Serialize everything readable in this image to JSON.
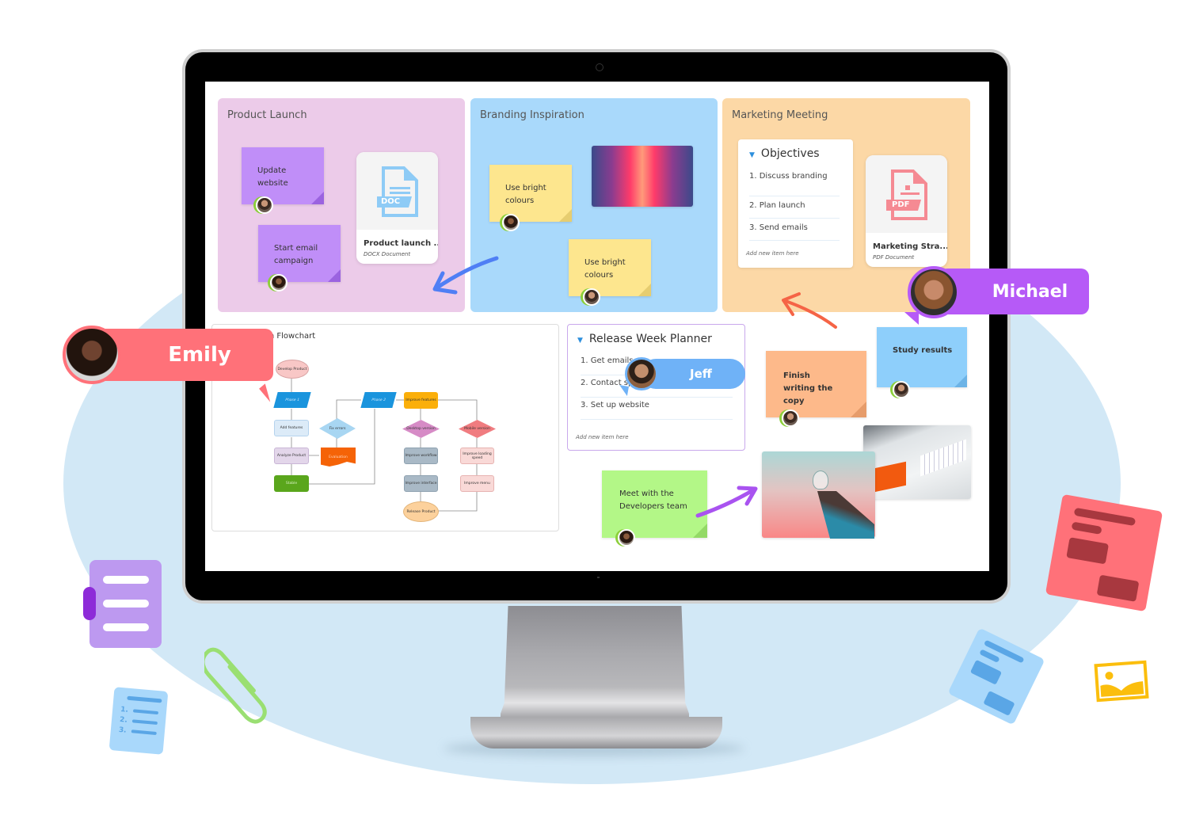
{
  "board": {
    "panels": [
      {
        "title": "Product Launch",
        "color": "#eccbe9"
      },
      {
        "title": "Branding Inspiration",
        "color": "#a9d9fb"
      },
      {
        "title": "Marketing Meeting",
        "color": "#fcd8a6"
      }
    ],
    "product_launch": {
      "stickies": [
        "Update website",
        "Start email campaign"
      ],
      "document": {
        "name": "Product launch ...",
        "type": "DOCX Document",
        "icon_label": "DOC"
      }
    },
    "branding": {
      "stickies": [
        "Use bright colours",
        "Use bright colours"
      ]
    },
    "marketing": {
      "objectives": {
        "title": "Objectives",
        "items": [
          "1.  Discuss branding",
          "2.  Plan launch",
          "3.  Send emails"
        ],
        "add_placeholder": "Add new item here"
      },
      "document": {
        "name": "Marketing Stra...",
        "type": "PDF Document",
        "icon_label": "PDF"
      }
    },
    "flowchart": {
      "title": "Launch Flowchart",
      "nodes": {
        "develop": "Develop Product",
        "phase1": "Phase 1",
        "add_features": "Add features",
        "analyze": "Analyze Product",
        "stable": "Stable",
        "fix_errors": "Fix errors",
        "evaluation": "Evaluation",
        "phase2": "Phase 2",
        "improve_features": "Improve features",
        "desktop": "Desktop version",
        "mobile": "Mobile version",
        "workflow": "Improve workflow",
        "interface": "Improve interface",
        "loading": "Improve loading speed",
        "menu": "Improve menu",
        "release": "Release Product"
      }
    },
    "release_planner": {
      "title": "Release Week Planner",
      "items": [
        "1.  Get emails",
        "2.  Contact sponsors",
        "3.  Set up website"
      ],
      "add_placeholder": "Add new item here"
    },
    "loose_stickies": {
      "finish_copy": "Finish writing the copy",
      "study_results": "Study results",
      "meet_devs": "Meet with the Developers team"
    }
  },
  "collaborators": [
    {
      "name": "Emily",
      "color": "#ff7179"
    },
    {
      "name": "Michael",
      "color": "#b65af7"
    },
    {
      "name": "Jeff",
      "color": "#6fb2f7"
    }
  ]
}
